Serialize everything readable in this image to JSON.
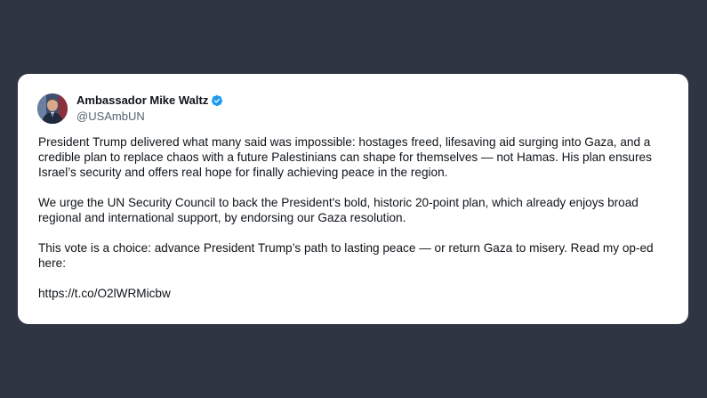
{
  "author": {
    "display_name": "Ambassador Mike Waltz",
    "handle": "@USAmbUN",
    "verified": true,
    "avatar_icon": "profile-photo",
    "verified_color": "#1d9bf0"
  },
  "tweet": {
    "paragraphs": [
      "President Trump delivered what many said was impossible: hostages freed, lifesaving aid surging into Gaza, and a credible plan to replace chaos with a future Palestinians can shape for themselves — not Hamas. His plan ensures Israel’s security and offers real hope for finally achieving peace in the region.",
      "We urge the UN Security Council to back the President's bold, historic 20-point plan, which already enjoys broad regional and international support, by endorsing our Gaza resolution.",
      "This vote is a choice: advance President Trump’s path to lasting peace — or return Gaza to misery.  Read my op-ed here:"
    ],
    "link": "https://t.co/O2lWRMicbw"
  },
  "colors": {
    "background": "#2f3542",
    "card": "#ffffff",
    "text": "#0f1419",
    "secondary_text": "#536471"
  }
}
